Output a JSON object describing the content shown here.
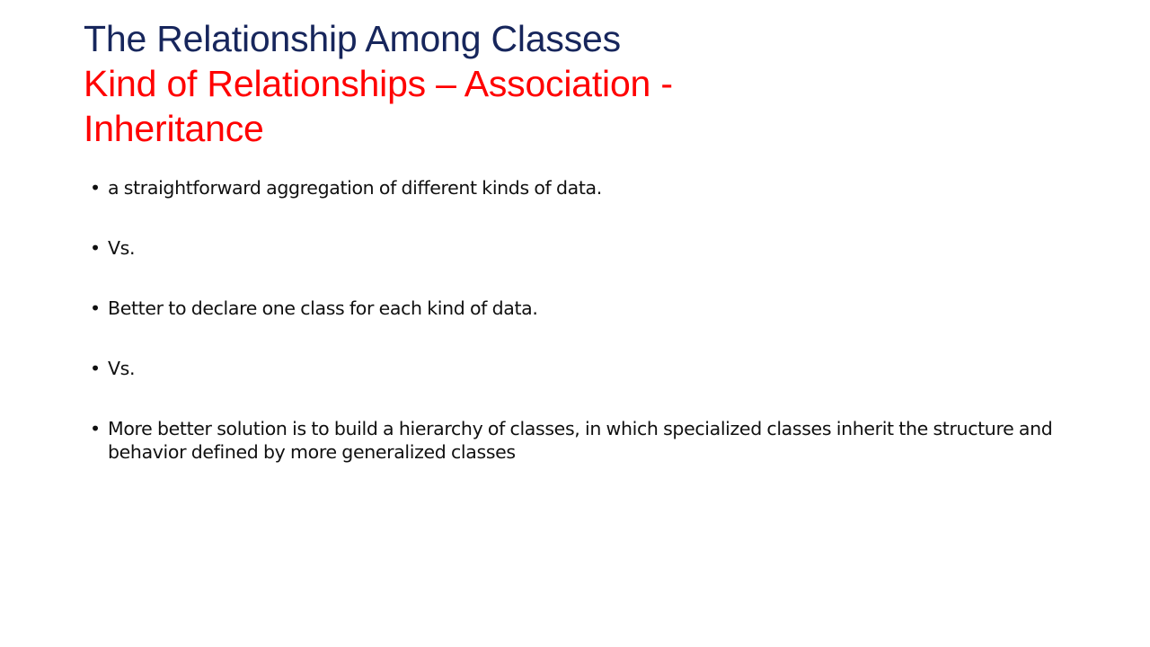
{
  "slide": {
    "background_color": "#FFFFFF",
    "title": {
      "line1": "The Relationship Among Classes",
      "line1_color": "#17265C",
      "line2": "Kind of Relationships – Association -",
      "line3": "Inheritance",
      "accent_color": "#FF0000"
    },
    "body": {
      "bullet_glyph": "•",
      "text_color": "#101010",
      "bullets": [
        {
          "text": "a straightforward aggregation of different kinds of data."
        },
        {
          "text": "Vs."
        },
        {
          "text": "Better to declare one class for each kind of data."
        },
        {
          "text": "Vs."
        },
        {
          "text": "More better solution is to build a hierarchy of classes, in which specialized classes inherit the structure and behavior defined by more generalized classes"
        }
      ]
    }
  }
}
